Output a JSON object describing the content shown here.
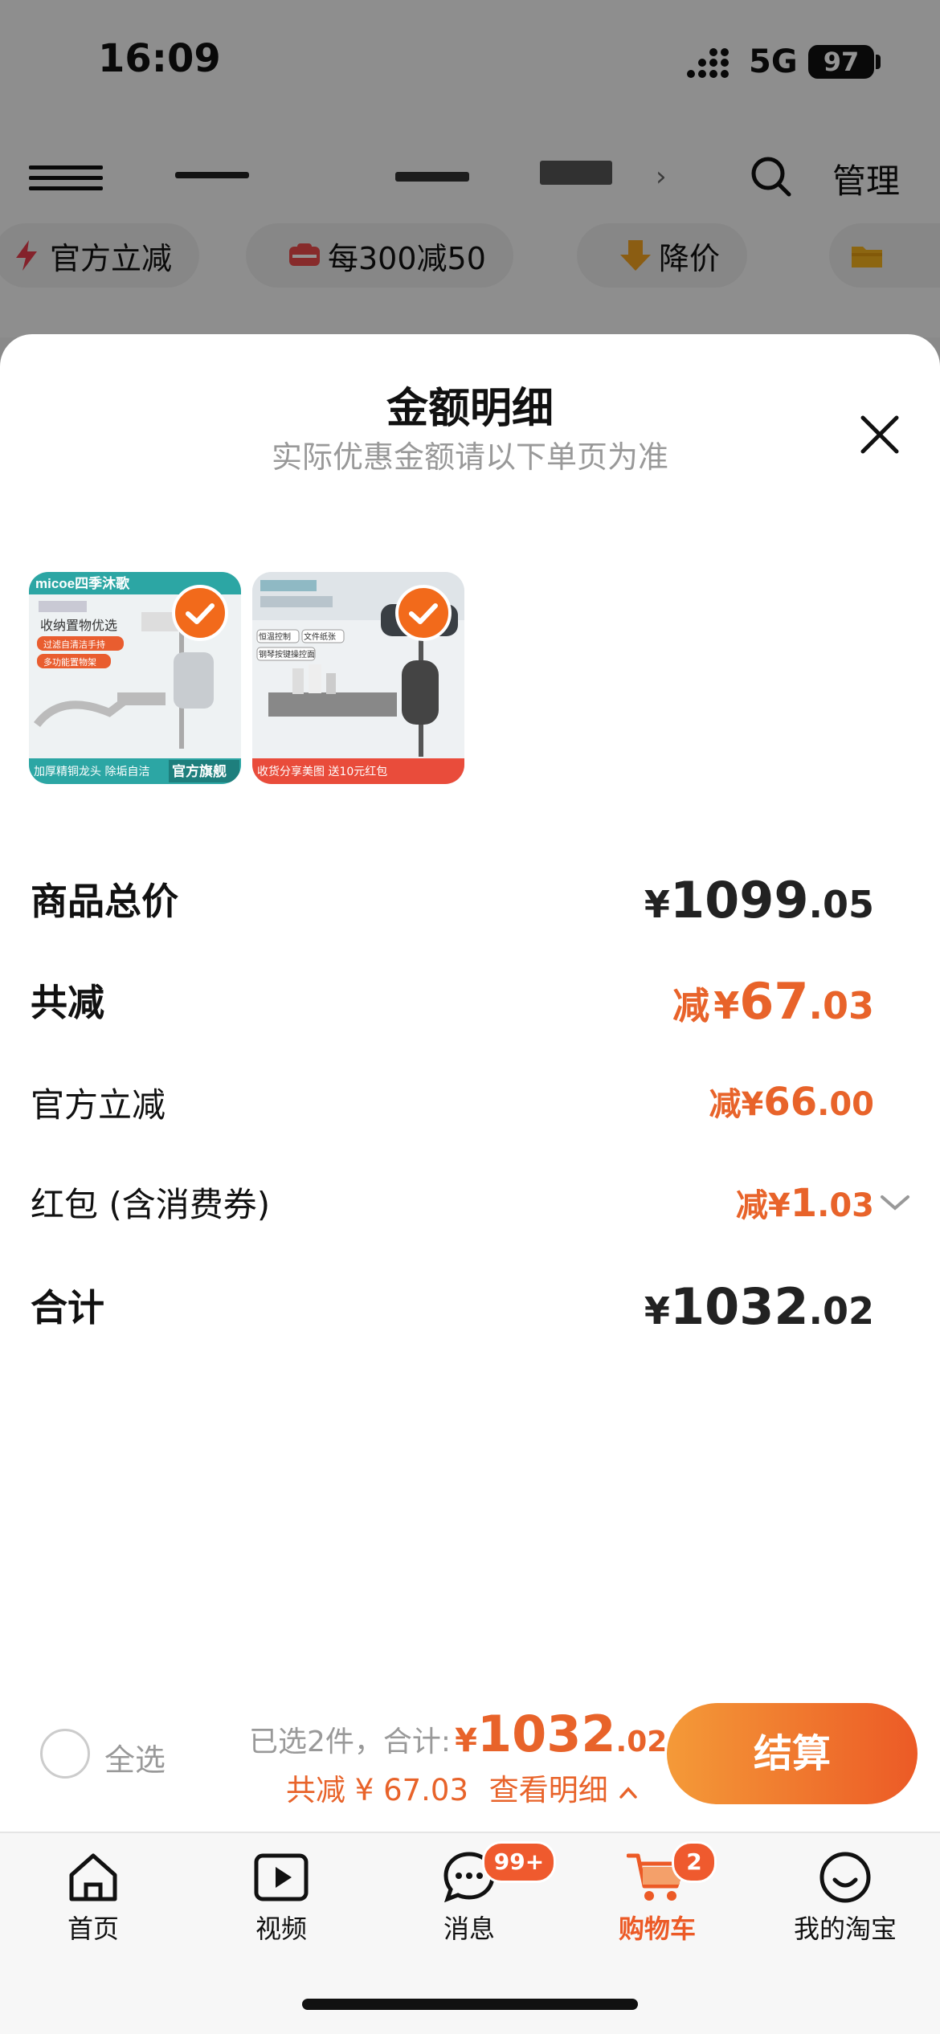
{
  "status": {
    "time": "16:09",
    "network": "5G",
    "battery": "97"
  },
  "header": {
    "manage_label": "管理"
  },
  "filters": [
    {
      "label": "官方立减",
      "icon": "lightning-icon"
    },
    {
      "label": "每300减50",
      "icon": "coupon-icon"
    },
    {
      "label": "降价",
      "icon": "price-drop-icon"
    },
    {
      "label": "",
      "icon": "folder-icon"
    }
  ],
  "sheet": {
    "title": "金额明细",
    "subtitle": "实际优惠金额请以下单页为准",
    "products": [
      {
        "brand": "micoe四季沐歌",
        "caption_top": "收纳置物优选",
        "tag1": "过滤自清洁手持",
        "tag2": "多功能置物架",
        "caption_bottom": "加厚精铜龙头 除垢自洁",
        "badge": "官方旗舰",
        "selected": true
      },
      {
        "tag1": "恒温控制",
        "tag2": "文件纸张",
        "tag3": "钢琴按键操控面",
        "caption_bottom": "收货分享美图 送10元红包",
        "selected": true
      }
    ],
    "rows": [
      {
        "label": "商品总价",
        "prefix": "",
        "currency": "¥",
        "integer": "1099",
        "decimal": ".05"
      },
      {
        "label": "共减",
        "prefix": "减",
        "currency": "¥",
        "integer": "67",
        "decimal": ".03"
      },
      {
        "label": "官方立减",
        "prefix": "减",
        "currency": "¥",
        "integer": "66",
        "decimal": ".00"
      },
      {
        "label": "红包 (含消费券)",
        "prefix": "减",
        "currency": "¥",
        "integer": "1",
        "decimal": ".03"
      },
      {
        "label": "合计",
        "prefix": "",
        "currency": "¥",
        "integer": "1032",
        "decimal": ".02"
      }
    ]
  },
  "actionbar": {
    "select_all": "全选",
    "selected_count": "已选2件，合计:",
    "currency": "¥",
    "total_int": "1032",
    "total_dec": ".02",
    "saved_text": "共减 ¥ 67.03",
    "detail_link": "查看明细",
    "checkout_label": "结算"
  },
  "tabs": [
    {
      "label": "首页",
      "icon": "home-icon"
    },
    {
      "label": "视频",
      "icon": "video-icon"
    },
    {
      "label": "消息",
      "icon": "message-icon",
      "badge": "99+"
    },
    {
      "label": "购物车",
      "icon": "cart-icon",
      "badge": "2",
      "active": true
    },
    {
      "label": "我的淘宝",
      "icon": "profile-icon"
    }
  ],
  "colors": {
    "accent": "#e8632a",
    "checkout_start": "#f49a38",
    "checkout_end": "#ec5a26",
    "badge": "#ef5a2e"
  }
}
